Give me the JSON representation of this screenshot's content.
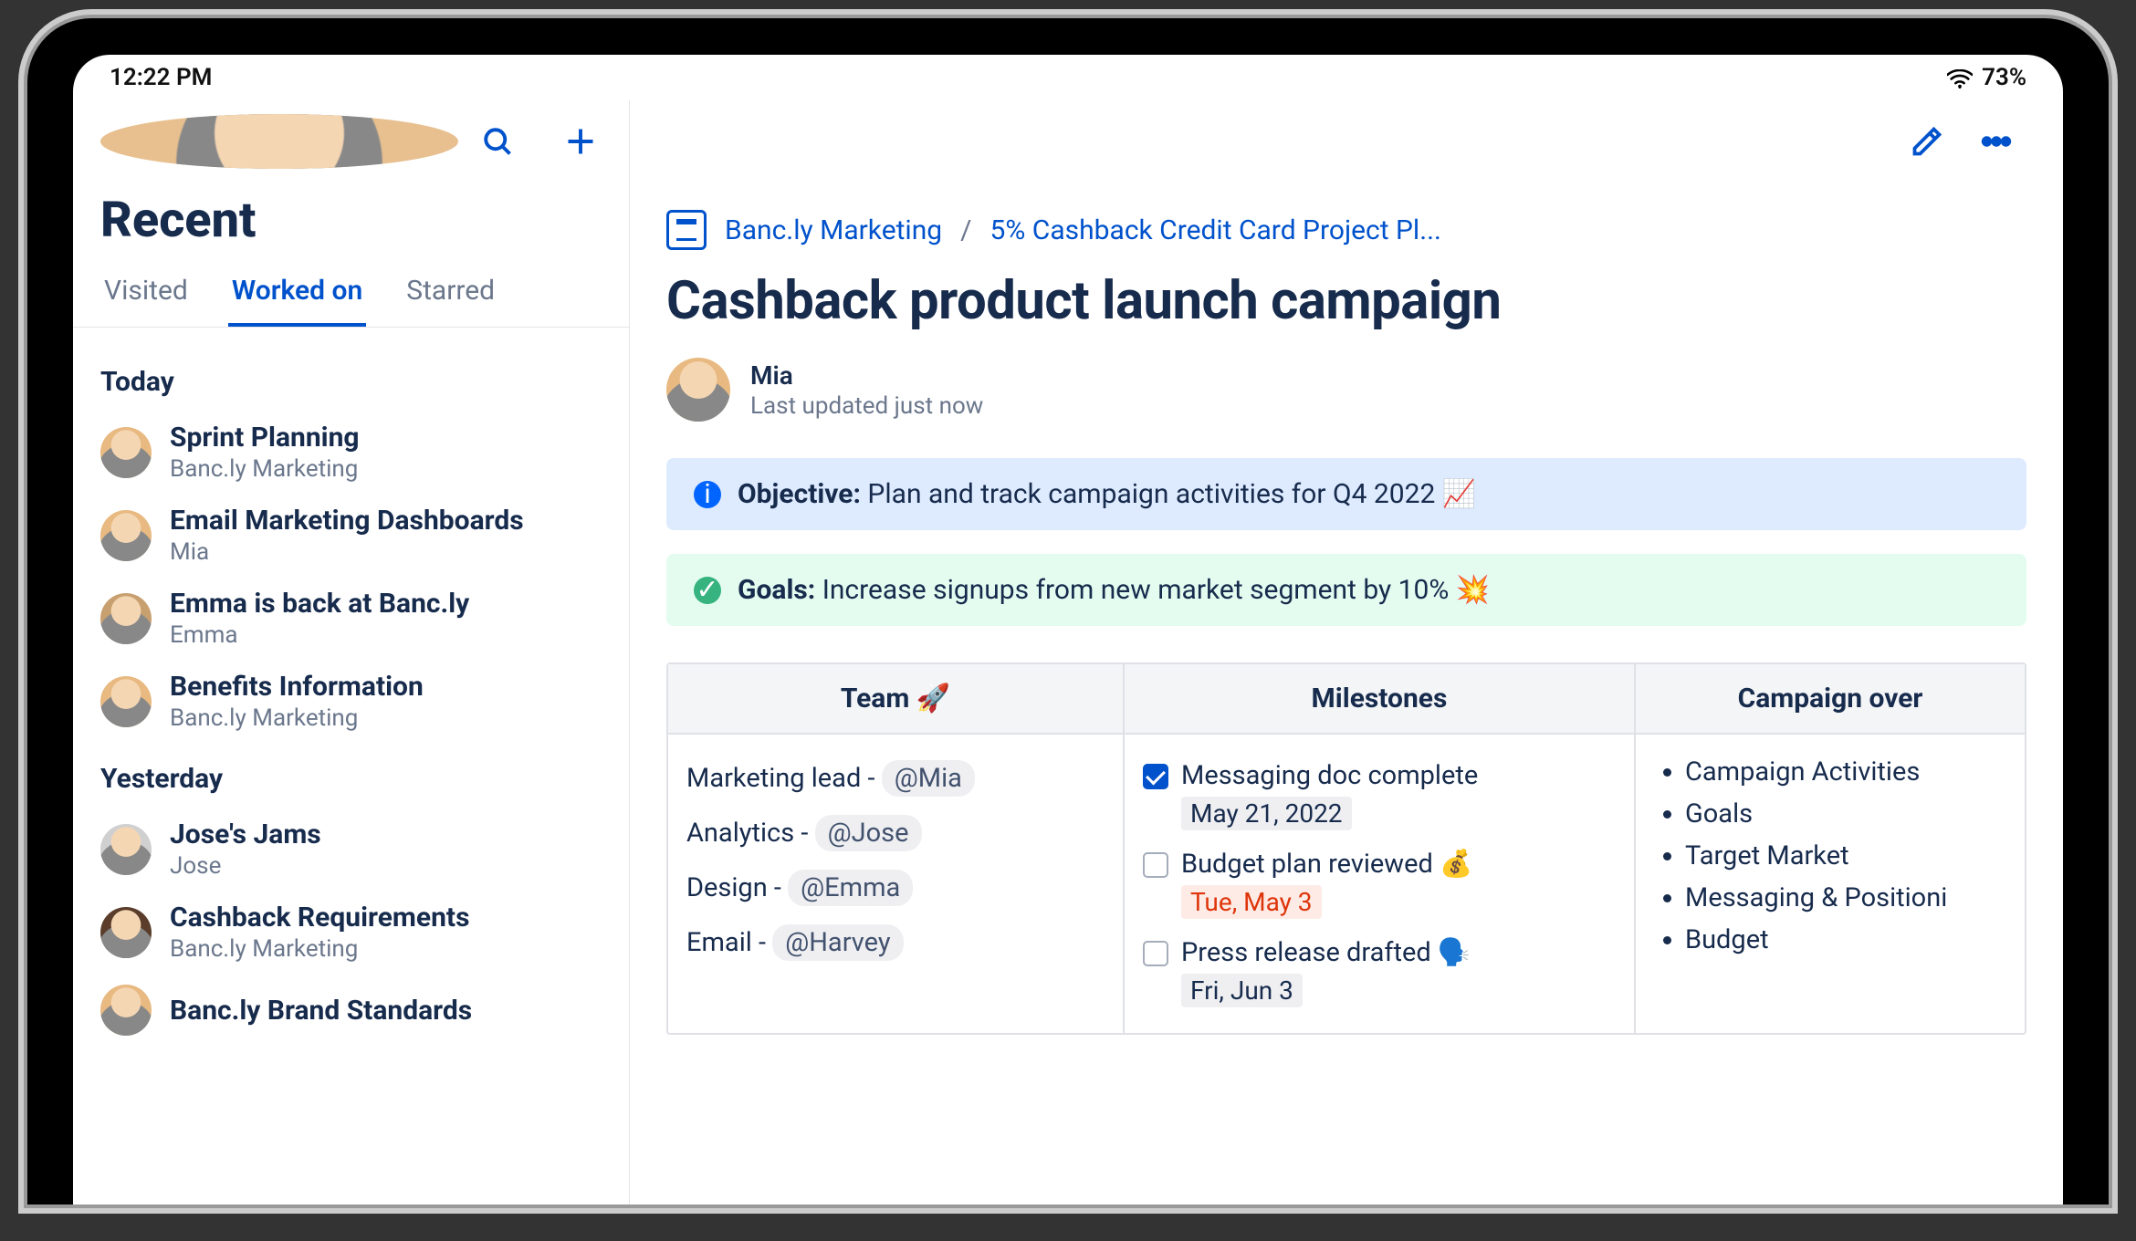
{
  "status": {
    "time": "12:22 PM",
    "battery": "73%"
  },
  "sidebar": {
    "title": "Recent",
    "tabs": [
      "Visited",
      "Worked on",
      "Starred"
    ],
    "active_tab": 1,
    "groups": [
      {
        "label": "Today",
        "items": [
          {
            "title": "Sprint Planning",
            "sub": "Banc.ly Marketing",
            "avatar": "mia"
          },
          {
            "title": "Email Marketing Dashboards",
            "sub": "Mia",
            "avatar": "mia"
          },
          {
            "title": "Emma is back at Banc.ly",
            "sub": "Emma",
            "avatar": "emma"
          },
          {
            "title": "Benefits Information",
            "sub": "Banc.ly Marketing",
            "avatar": "mia"
          }
        ]
      },
      {
        "label": "Yesterday",
        "items": [
          {
            "title": "Jose's Jams",
            "sub": "Jose",
            "avatar": "jose"
          },
          {
            "title": "Cashback Requirements",
            "sub": "Banc.ly Marketing",
            "avatar": "dark"
          },
          {
            "title": "Banc.ly Brand Standards",
            "sub": "",
            "avatar": "mia"
          }
        ]
      }
    ]
  },
  "page": {
    "breadcrumb": {
      "space": "Banc.ly Marketing",
      "parent": "5% Cashback Credit Card Project Pl..."
    },
    "title": "Cashback product launch campaign",
    "author": {
      "name": "Mia",
      "meta": "Last updated just now"
    },
    "objective": {
      "label": "Objective:",
      "text": "Plan and track campaign activities for Q4 2022",
      "emoji": "📈"
    },
    "goals": {
      "label": "Goals:",
      "text": "Increase signups from new market segment by 10%",
      "emoji": "💥"
    },
    "table": {
      "headers": {
        "team": "Team 🚀",
        "milestones": "Milestones",
        "campaign": "Campaign over"
      },
      "team": [
        {
          "role": "Marketing lead -",
          "mention": "@Mia"
        },
        {
          "role": "Analytics -",
          "mention": "@Jose"
        },
        {
          "role": "Design -",
          "mention": "@Emma"
        },
        {
          "role": "Email -",
          "mention": "@Harvey"
        }
      ],
      "milestones": [
        {
          "checked": true,
          "text": "Messaging doc complete",
          "date": "May 21, 2022",
          "overdue": false,
          "emoji": ""
        },
        {
          "checked": false,
          "text": "Budget plan reviewed",
          "date": "Tue, May 3",
          "overdue": true,
          "emoji": "💰"
        },
        {
          "checked": false,
          "text": "Press release drafted",
          "date": "Fri, Jun 3",
          "overdue": false,
          "emoji": "🗣️"
        }
      ],
      "campaign": [
        "Campaign Activities",
        "Goals",
        "Target Market",
        "Messaging & Positioni",
        "Budget"
      ]
    }
  }
}
